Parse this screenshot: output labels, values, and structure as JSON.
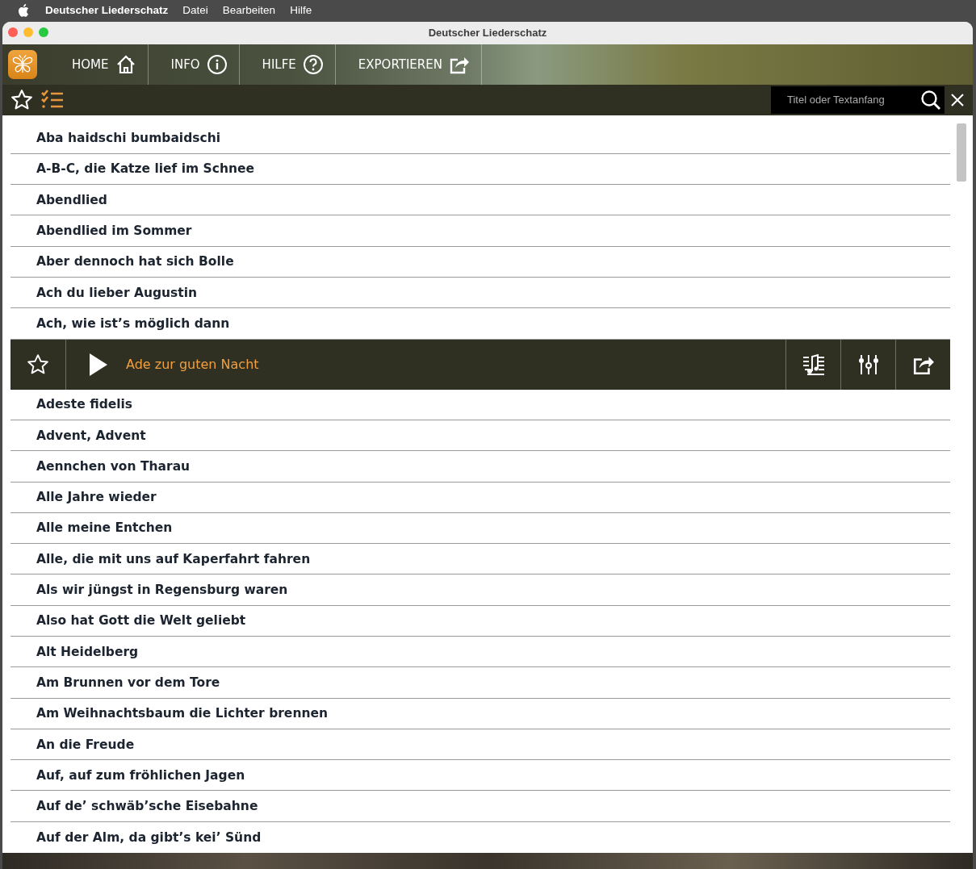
{
  "menu_bar": {
    "app_name": "Deutscher Liederschatz",
    "items": [
      "Datei",
      "Bearbeiten",
      "Hilfe"
    ]
  },
  "window": {
    "title": "Deutscher Liederschatz"
  },
  "nav": [
    {
      "label": "HOME",
      "kind": "home"
    },
    {
      "label": "INFO",
      "kind": "info"
    },
    {
      "label": "HILFE",
      "kind": "help"
    },
    {
      "label": "EXPORTIEREN",
      "kind": "export"
    }
  ],
  "search": {
    "placeholder": "Titel oder Textanfang"
  },
  "songs": [
    {
      "title": "Aba haidschi bumbaidschi",
      "selected": false
    },
    {
      "title": "A-B-C, die Katze lief im Schnee",
      "selected": false
    },
    {
      "title": "Abendlied",
      "selected": false
    },
    {
      "title": "Abendlied im Sommer",
      "selected": false
    },
    {
      "title": "Aber dennoch hat sich Bolle",
      "selected": false
    },
    {
      "title": "Ach du lieber Augustin",
      "selected": false
    },
    {
      "title": "Ach, wie ist’s möglich dann",
      "selected": false
    },
    {
      "title": "Ade zur guten Nacht",
      "selected": true
    },
    {
      "title": "Adeste fidelis",
      "selected": false
    },
    {
      "title": "Advent, Advent",
      "selected": false
    },
    {
      "title": "Aennchen von Tharau",
      "selected": false
    },
    {
      "title": "Alle Jahre wieder",
      "selected": false
    },
    {
      "title": "Alle meine Entchen",
      "selected": false
    },
    {
      "title": "Alle, die mit uns auf Kaperfahrt fahren",
      "selected": false
    },
    {
      "title": "Als wir jüngst in Regensburg waren",
      "selected": false
    },
    {
      "title": "Also hat Gott die Welt geliebt",
      "selected": false
    },
    {
      "title": "Alt Heidelberg",
      "selected": false
    },
    {
      "title": "Am Brunnen vor dem Tore",
      "selected": false
    },
    {
      "title": "Am Weihnachtsbaum die Lichter brennen",
      "selected": false
    },
    {
      "title": "An die Freude",
      "selected": false
    },
    {
      "title": "Auf, auf zum fröhlichen Jagen",
      "selected": false
    },
    {
      "title": "Auf de’ schwäb’sche Eisebahne",
      "selected": false
    },
    {
      "title": "Auf der Alm, da gibt’s kei’ Sünd",
      "selected": false
    }
  ]
}
